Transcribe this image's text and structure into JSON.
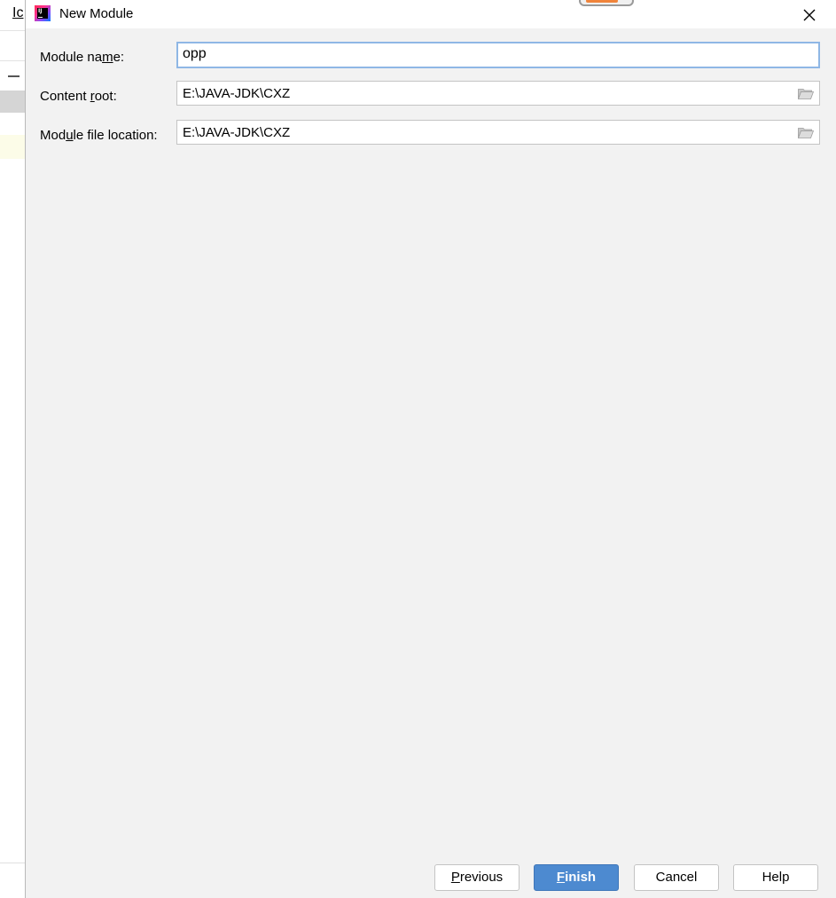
{
  "background_window": {
    "menu_letter": "I",
    "menu_letter2": "c"
  },
  "dialog": {
    "title": "New Module",
    "close_icon": "close-icon",
    "fields": [
      {
        "label_pre": "Module na",
        "label_mnemonic": "m",
        "label_post": "e:",
        "value": "opp"
      },
      {
        "label_pre": "Content ",
        "label_mnemonic": "r",
        "label_post": "oot:",
        "value": "E:\\JAVA-JDK\\CXZ"
      },
      {
        "label_pre": "Mod",
        "label_mnemonic": "u",
        "label_post": "le file location:",
        "value": "E:\\JAVA-JDK\\CXZ"
      }
    ],
    "buttons": {
      "previous_mnemonic": "P",
      "previous_rest": "revious",
      "finish_mnemonic": "F",
      "finish_rest": "inish",
      "cancel": "Cancel",
      "help": "Help"
    }
  },
  "colors": {
    "dialog_bg": "#f2f2f2",
    "primary_button": "#4d8ad0",
    "focus_border": "#8fb7e5",
    "drag_accent": "#f0843b"
  }
}
